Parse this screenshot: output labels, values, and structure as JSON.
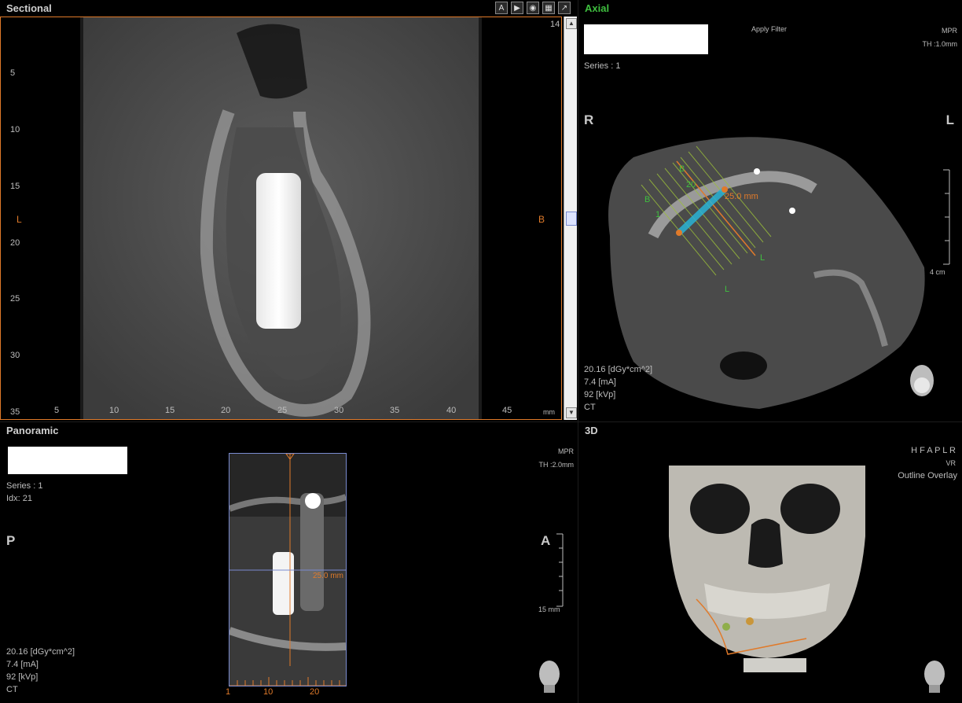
{
  "sectional": {
    "title": "Sectional",
    "slice_number": "14",
    "left_label": "L",
    "right_label": "B",
    "unit": "mm",
    "y_ticks": [
      "5",
      "10",
      "15",
      "20",
      "25",
      "30",
      "35"
    ],
    "x_ticks": [
      "5",
      "10",
      "15",
      "20",
      "25",
      "30",
      "35",
      "40",
      "45"
    ],
    "toolbar": [
      "A",
      "▶",
      "◉",
      "▦",
      "↗"
    ]
  },
  "axial": {
    "title": "Axial",
    "apply_filter": "Apply Filter",
    "mode": "MPR",
    "thickness": "TH :1.0mm",
    "series": "Series : 1",
    "left_label": "R",
    "right_label": "L",
    "measure": "25.0 mm",
    "overlay_labels": {
      "b1": "B",
      "b2": "B",
      "n20": "20",
      "n1": "1",
      "l1": "L",
      "l2": "L"
    },
    "scale_label": "4 cm",
    "dose": "20.16  [dGy*cm^2]",
    "current": "7.4  [mA]",
    "voltage": "92 [kVp]",
    "modality": "CT"
  },
  "panoramic": {
    "title": "Panoramic",
    "mode": "MPR",
    "thickness": "TH :2.0mm",
    "series": "Series : 1",
    "idx": "Idx: 21",
    "left_label": "P",
    "right_label": "A",
    "measure": "25.0 mm",
    "scale_label": "15 mm",
    "x_ticks": [
      "1",
      "10",
      "20"
    ],
    "dose": "20.16  [dGy*cm^2]",
    "current": "7.4  [mA]",
    "voltage": "92 [kVp]",
    "modality": "CT"
  },
  "view3d": {
    "title": "3D",
    "orient": "H F A P L R",
    "render": "VR",
    "overlay": "Outline Overlay"
  },
  "colors": {
    "accent": "#e07a2a",
    "green": "#3fbf3f",
    "implant": "#ffffff"
  }
}
